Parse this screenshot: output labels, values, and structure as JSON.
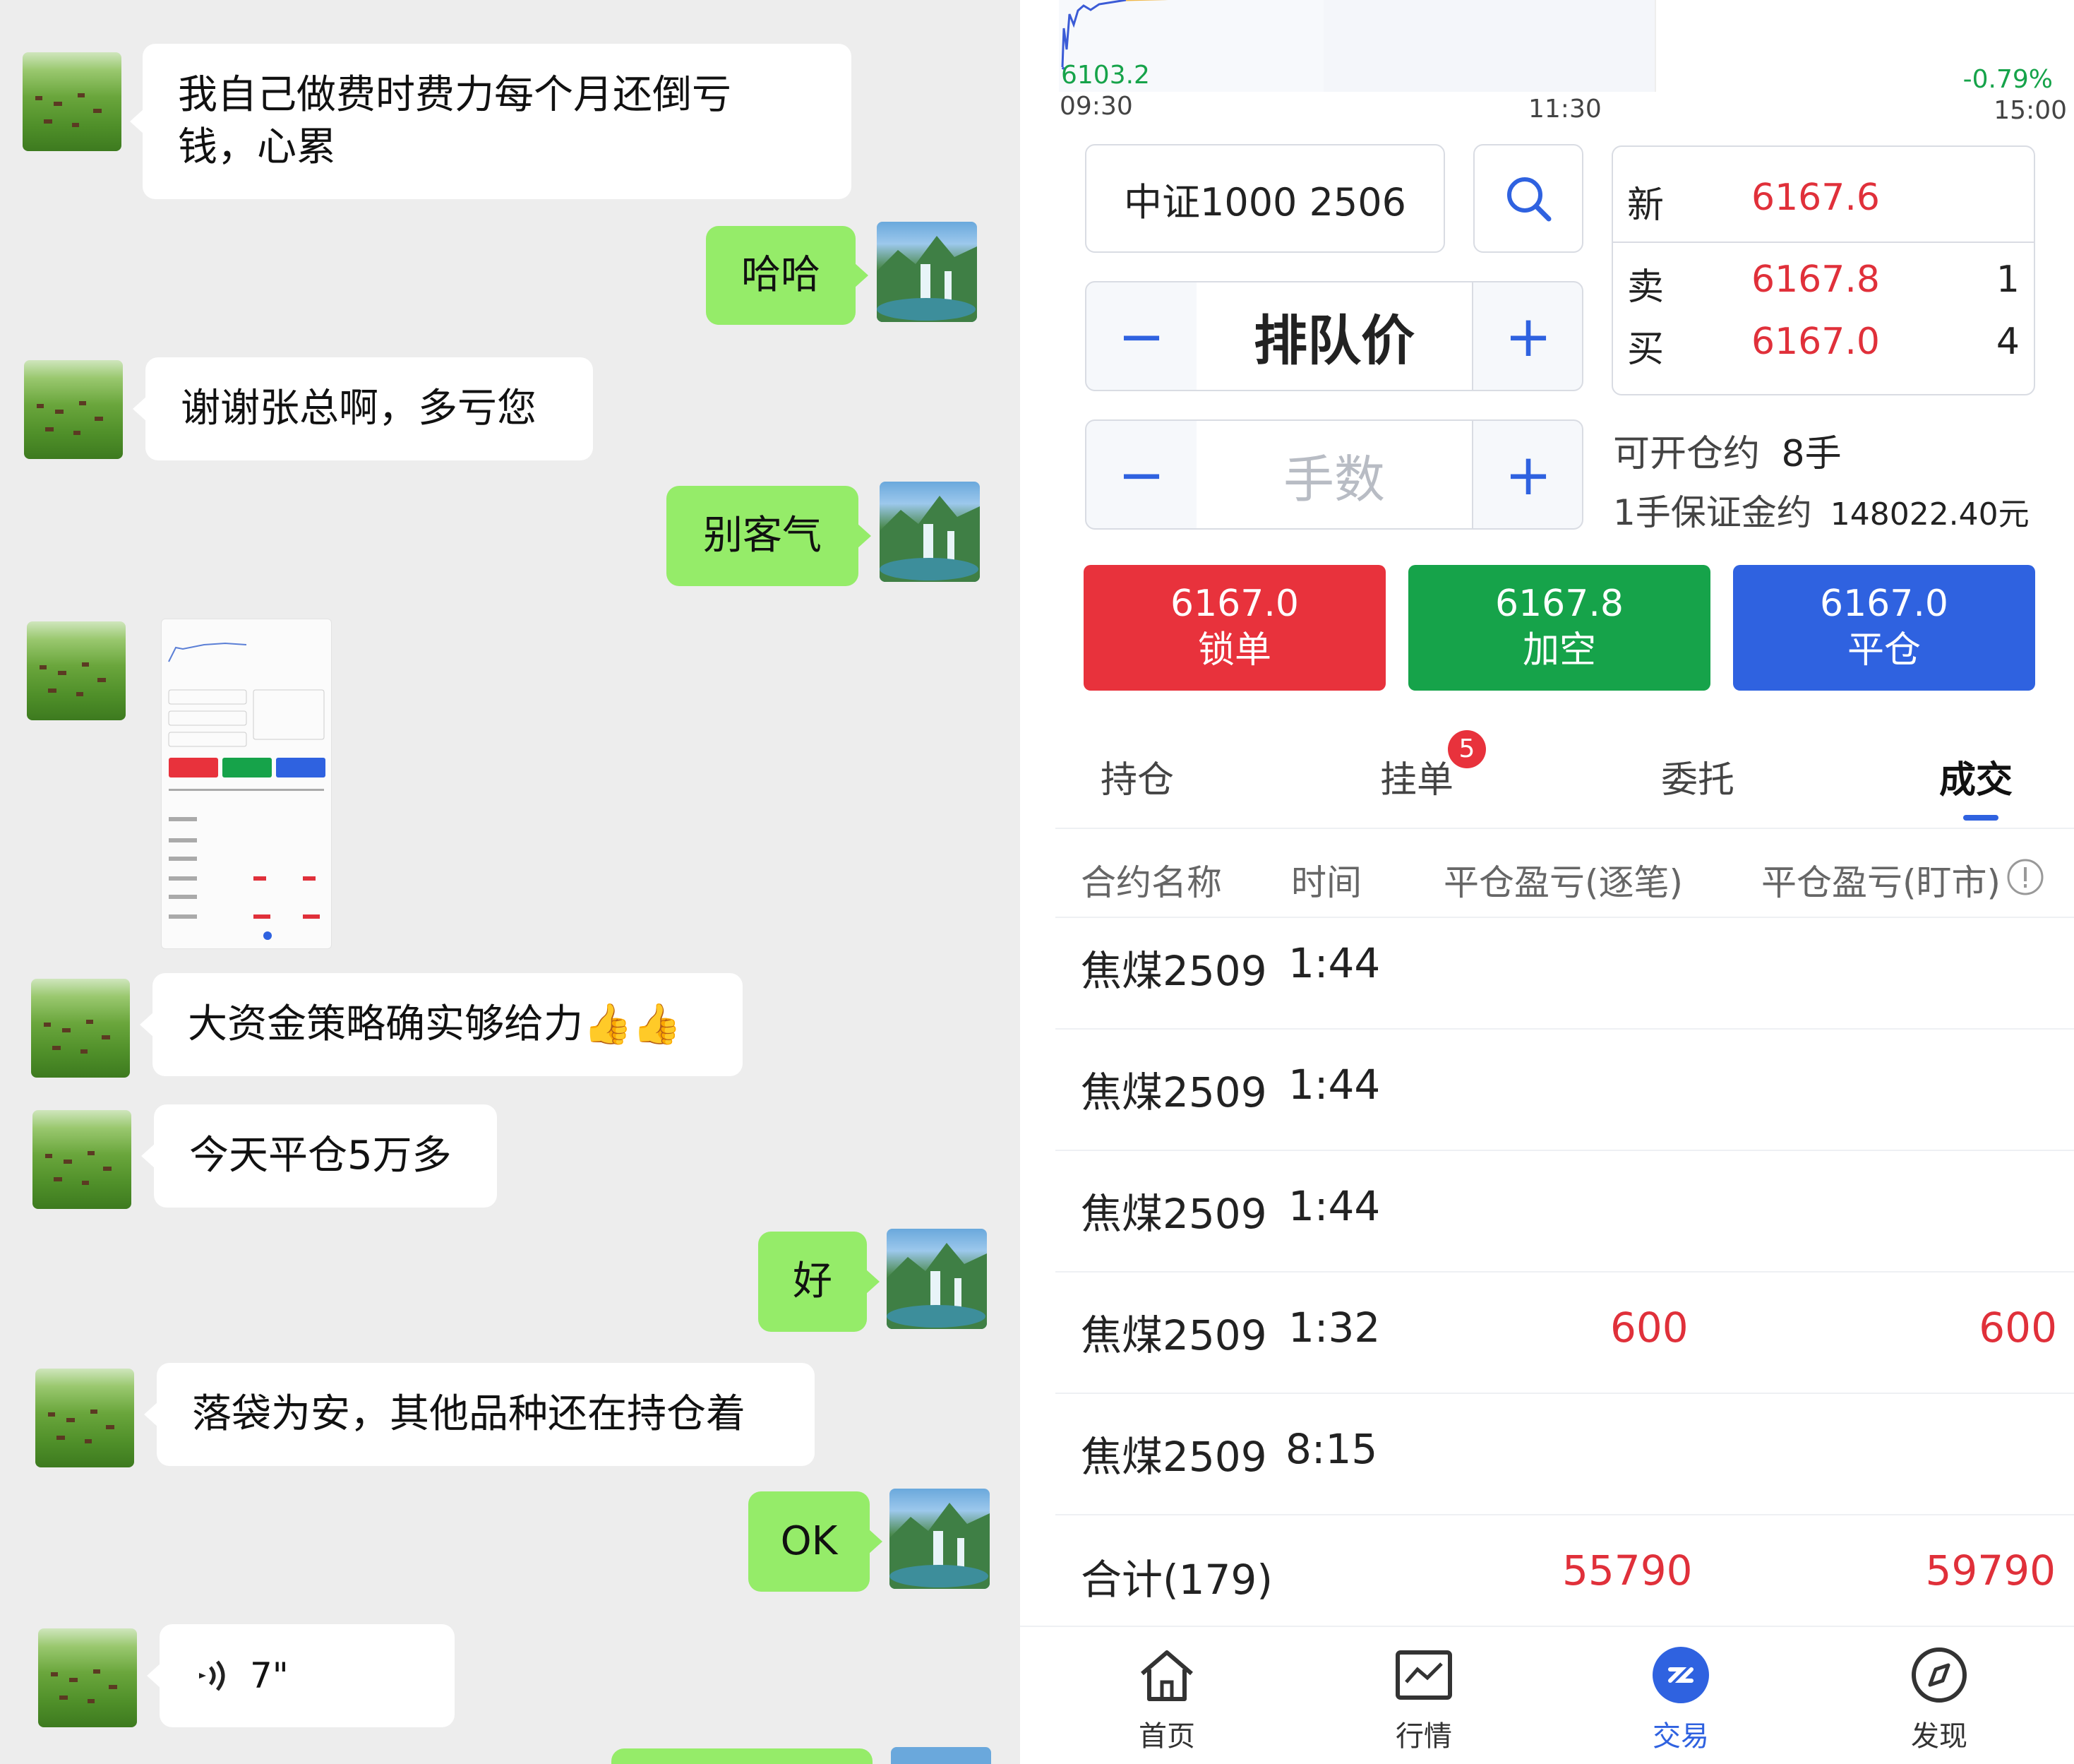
{
  "chat": {
    "messages": [
      {
        "side": "in",
        "text": "我自己做费时费力每个月还倒亏钱，心累"
      },
      {
        "side": "out",
        "text": "哈哈"
      },
      {
        "side": "in",
        "text": "谢谢张总啊，多亏您"
      },
      {
        "side": "out",
        "text": "别客气"
      },
      {
        "side": "in",
        "type": "image"
      },
      {
        "side": "in",
        "text": "大资金策略确实够给力👍👍"
      },
      {
        "side": "in",
        "text": "今天平仓5万多"
      },
      {
        "side": "out",
        "text": "好"
      },
      {
        "side": "in",
        "text": "落袋为安，其他品种还在持仓着"
      },
      {
        "side": "out",
        "text": "OK"
      },
      {
        "side": "in",
        "type": "voice",
        "duration": "7\""
      }
    ],
    "msg1_line1": "我自己做费时费力每个月还倒亏",
    "msg1_line2": "钱，心累",
    "voice_icon": "voice-wave-icon"
  },
  "chart": {
    "low_label": "6103.2",
    "change_label": "-0.79%",
    "time_start": "09:30",
    "time_mid": "11:30",
    "time_end": "15:00"
  },
  "order": {
    "contract": "中证1000 2506",
    "search_icon": "search-icon",
    "price_mode": "排队价",
    "lots_placeholder": "手数",
    "minus": "−",
    "plus": "+"
  },
  "quote": {
    "last_label": "新",
    "last": "6167.6",
    "ask_label": "卖",
    "ask": "6167.8",
    "ask_vol": "1",
    "bid_label": "买",
    "bid": "6167.0",
    "bid_vol": "4"
  },
  "margin": {
    "open_label": "可开仓约",
    "open_value": "8手",
    "margin_label": "1手保证金约",
    "margin_value": "148022.40元"
  },
  "actions": [
    {
      "price": "6167.0",
      "label": "锁单",
      "color": "#e8323c"
    },
    {
      "price": "6167.8",
      "label": "加空",
      "color": "#16a34a"
    },
    {
      "price": "6167.0",
      "label": "平仓",
      "color": "#2f62e0"
    }
  ],
  "tabs": [
    {
      "label": "持仓"
    },
    {
      "label": "挂单",
      "badge": "5"
    },
    {
      "label": "委托"
    },
    {
      "label": "成交",
      "active": true
    }
  ],
  "columns": [
    "合约名称",
    "时间",
    "平仓盈亏(逐笔)",
    "平仓盈亏(盯市)"
  ],
  "rows": [
    {
      "name": "焦煤2509",
      "time": "1:44",
      "pnl1": "",
      "pnl2": ""
    },
    {
      "name": "焦煤2509",
      "time": "1:44",
      "pnl1": "",
      "pnl2": ""
    },
    {
      "name": "焦煤2509",
      "time": "1:44",
      "pnl1": "",
      "pnl2": ""
    },
    {
      "name": "焦煤2509",
      "time": "1:32",
      "pnl1": "600",
      "pnl2": "600"
    },
    {
      "name": "焦煤2509",
      "time": "8:15",
      "pnl1": "",
      "pnl2": ""
    }
  ],
  "total": {
    "label": "合计(179)",
    "pnl1": "55790",
    "pnl2": "59790"
  },
  "nav": [
    {
      "label": "首页",
      "icon": "home-icon"
    },
    {
      "label": "行情",
      "icon": "chart-icon"
    },
    {
      "label": "交易",
      "icon": "trade-icon",
      "active": true
    },
    {
      "label": "发现",
      "icon": "compass-icon"
    }
  ]
}
